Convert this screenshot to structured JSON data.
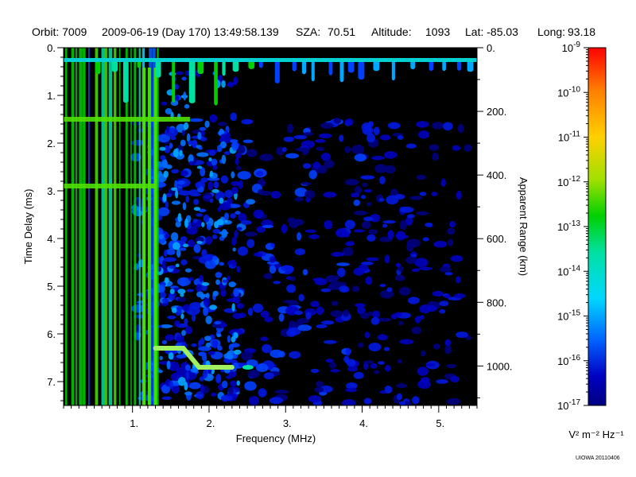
{
  "header": {
    "orbit": "Orbit: 7009",
    "datetime": "2009-06-19 (Day 170) 13:49:58.139",
    "sza_label": "SZA:",
    "sza_value": "70.51",
    "altitude_label": "Altitude:",
    "altitude_value": "1093",
    "lat": "Lat: -85.03",
    "long_label": "Long:",
    "long_value": "93.18"
  },
  "chart_data": {
    "type": "heatmap",
    "xlabel": "Frequency (MHz)",
    "ylabel": "Time Delay (ms)",
    "y2label": "Apparent Range (km)",
    "xlim": [
      0.1,
      5.5
    ],
    "ylim": [
      0,
      7.5
    ],
    "x_ticks": [
      {
        "v": 1,
        "t": "1."
      },
      {
        "v": 2,
        "t": "2."
      },
      {
        "v": 3,
        "t": "3."
      },
      {
        "v": 4,
        "t": "4."
      },
      {
        "v": 5,
        "t": "5."
      }
    ],
    "y_ticks": [
      {
        "v": 0,
        "t": "0."
      },
      {
        "v": 1,
        "t": "1."
      },
      {
        "v": 2,
        "t": "2."
      },
      {
        "v": 3,
        "t": "3."
      },
      {
        "v": 4,
        "t": "4."
      },
      {
        "v": 5,
        "t": "5."
      },
      {
        "v": 6,
        "t": "6."
      },
      {
        "v": 7,
        "t": "7."
      }
    ],
    "y2_ticks": [
      {
        "v": 0,
        "t": "0."
      },
      {
        "v": 200,
        "t": "200."
      },
      {
        "v": 400,
        "t": "400."
      },
      {
        "v": 600,
        "t": "600."
      },
      {
        "v": 800,
        "t": "800."
      },
      {
        "v": 1000,
        "t": "1000."
      }
    ],
    "y2lim": [
      0,
      1124
    ],
    "background_color": "#000000",
    "colorbar": {
      "log_min": -17,
      "log_max": -9,
      "ticks": [
        "10^-9",
        "10^-10",
        "10^-11",
        "10^-12",
        "10^-13",
        "10^-14",
        "10^-15",
        "10^-16",
        "10^-17"
      ],
      "unit": "V² m⁻² Hz⁻¹",
      "colors": [
        "#ff0000",
        "#ff8000",
        "#ffd000",
        "#a0e000",
        "#00d000",
        "#00e0a0",
        "#00d8ff",
        "#0060ff",
        "#0000c0",
        "#000080"
      ]
    },
    "features": [
      {
        "name": "surface-reflection",
        "x_start": 1.3,
        "x_end": 2.3,
        "delay_start": 6.3,
        "delay_end": 6.7
      },
      {
        "name": "local-plasma-line",
        "delay": 1.5,
        "x_start": 0.1,
        "x_end": 1.75
      },
      {
        "name": "local-plasma-line-2",
        "delay": 2.9,
        "x_start": 0.1,
        "x_end": 1.3
      }
    ]
  },
  "credit": "UIOWA 20110406"
}
